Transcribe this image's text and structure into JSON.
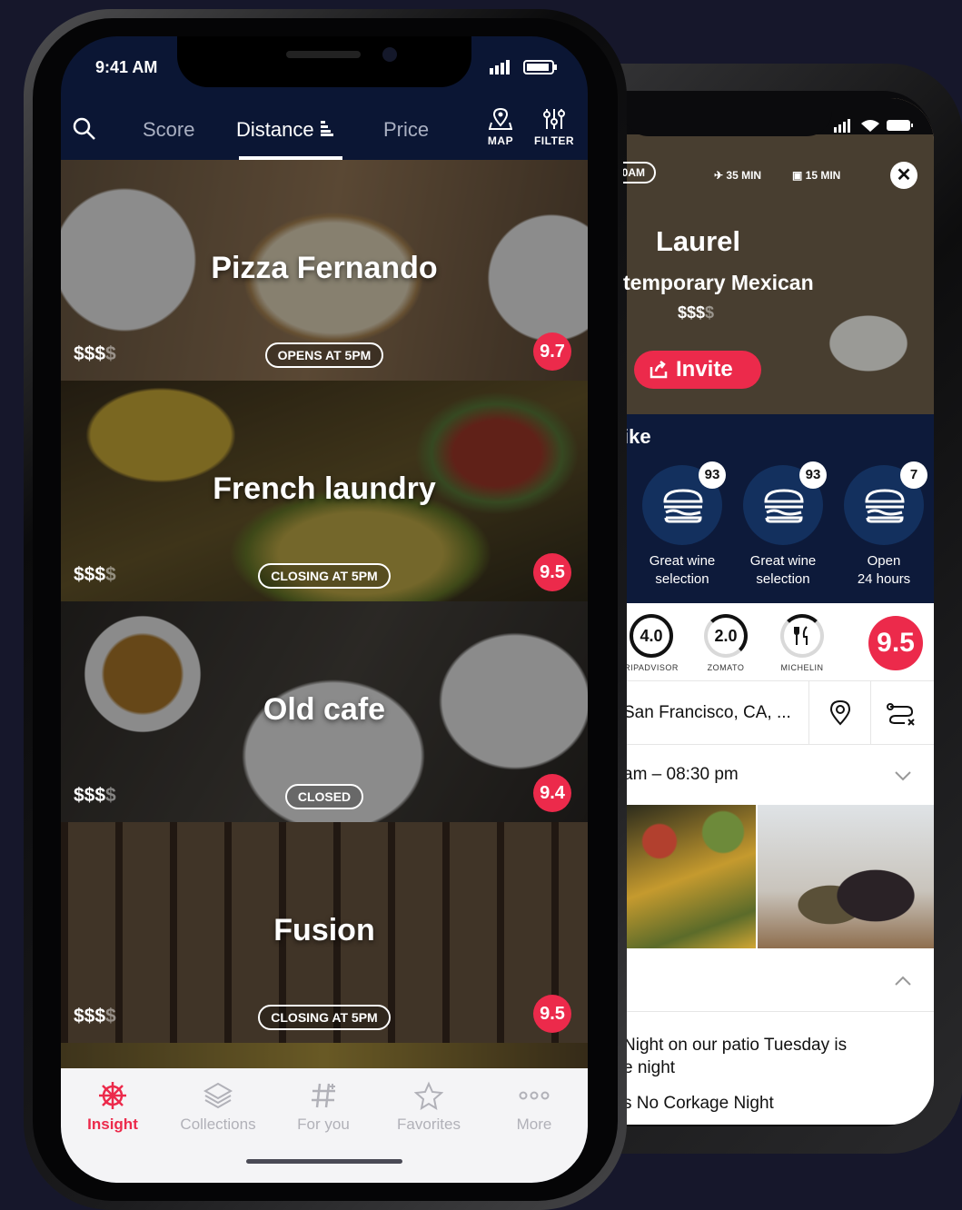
{
  "colors": {
    "accent": "#ec2a4b",
    "navy": "#0b1634",
    "background": "#16172b"
  },
  "front": {
    "status": {
      "time": "9:41 AM"
    },
    "nav": {
      "tabs": [
        {
          "label": "Score",
          "active": false
        },
        {
          "label": "Distance",
          "active": true
        },
        {
          "label": "Price",
          "active": false
        }
      ],
      "map_label": "MAP",
      "filter_label": "FILTER",
      "icons": [
        "search-icon",
        "sort-icon",
        "map-pin-icon",
        "filter-icon"
      ]
    },
    "restaurants": [
      {
        "name": "Pizza Fernando",
        "price": "$$$",
        "price_dim": "$",
        "status": "OPENS AT 5PM",
        "rating": "9.7"
      },
      {
        "name": "French laundry",
        "price": "$$$",
        "price_dim": "$",
        "status": "CLOSING AT 5PM",
        "rating": "9.5"
      },
      {
        "name": "Old cafe",
        "price": "$$$",
        "price_dim": "$",
        "status": "CLOSED",
        "rating": "9.4"
      },
      {
        "name": "Fusion",
        "price": "$$$",
        "price_dim": "$",
        "status": "CLOSING AT 5PM",
        "rating": "9.5"
      }
    ],
    "tabbar": [
      {
        "label": "Insight",
        "icon": "ship-wheel-icon",
        "active": true
      },
      {
        "label": "Collections",
        "icon": "layers-icon",
        "active": false
      },
      {
        "label": "For you",
        "icon": "hashtag-icon",
        "active": false
      },
      {
        "label": "Favorites",
        "icon": "star-icon",
        "active": false
      },
      {
        "label": "More",
        "icon": "more-icon",
        "active": false
      }
    ]
  },
  "detail": {
    "distance_pill": "10AM",
    "walk_time": "35 MIN",
    "drive_time": "15 MIN",
    "name": "Laurel",
    "cuisine": "temporary Mexican",
    "price": "$$$",
    "price_dim": "$",
    "invite_label": "Invite",
    "likes_title": "ike",
    "likes": [
      {
        "count": "93",
        "line1": "Great wine",
        "line2": "selection"
      },
      {
        "count": "93",
        "line1": "Great wine",
        "line2": "selection"
      },
      {
        "count": "7",
        "line1": "Open",
        "line2": "24 hours"
      }
    ],
    "scores": [
      {
        "value": "4.0",
        "source": "RIPADVISOR"
      },
      {
        "value": "2.0",
        "source": "ZOMATO"
      },
      {
        "value": "",
        "source": "MICHELIN"
      }
    ],
    "overall": "9.5",
    "address": "San Francisco, CA, ...",
    "hours": "am – 08:30 pm",
    "note_line1": "Night on our patio Tuesday is",
    "note_line2": "e night",
    "note_line3": "s No Corkage Night"
  }
}
